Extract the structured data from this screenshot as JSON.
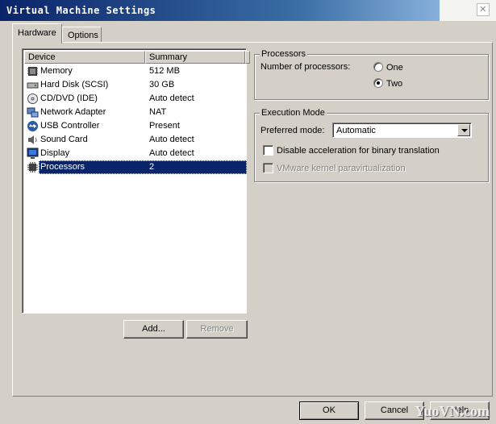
{
  "window": {
    "title": "Virtual Machine Settings"
  },
  "tabs": [
    {
      "label": "Hardware",
      "active": true
    },
    {
      "label": "Options",
      "active": false
    }
  ],
  "device_list": {
    "columns": [
      "Device",
      "Summary"
    ],
    "rows": [
      {
        "device": "Memory",
        "summary": "512 MB",
        "icon": "memory-icon"
      },
      {
        "device": "Hard Disk (SCSI)",
        "summary": "30 GB",
        "icon": "hard-disk-icon"
      },
      {
        "device": "CD/DVD (IDE)",
        "summary": "Auto detect",
        "icon": "cd-dvd-icon"
      },
      {
        "device": "Network Adapter",
        "summary": "NAT",
        "icon": "network-adapter-icon"
      },
      {
        "device": "USB Controller",
        "summary": "Present",
        "icon": "usb-icon"
      },
      {
        "device": "Sound Card",
        "summary": "Auto detect",
        "icon": "sound-card-icon"
      },
      {
        "device": "Display",
        "summary": "Auto detect",
        "icon": "display-icon"
      },
      {
        "device": "Processors",
        "summary": "2",
        "icon": "processor-icon",
        "selected": true
      }
    ]
  },
  "list_buttons": {
    "add": "Add...",
    "remove": "Remove"
  },
  "processors_group": {
    "title": "Processors",
    "count_label": "Number of processors:",
    "options": [
      "One",
      "Two"
    ],
    "selected": "Two"
  },
  "execution_group": {
    "title": "Execution Mode",
    "preferred_mode_label": "Preferred mode:",
    "preferred_mode_value": "Automatic",
    "disable_accel_label": "Disable acceleration for binary translation",
    "disable_accel_checked": false,
    "paravirt_label": "VMware kernel paravirtualization",
    "paravirt_checked": false,
    "paravirt_enabled": false
  },
  "dialog_buttons": {
    "ok": "OK",
    "cancel": "Cancel",
    "help": "Help"
  },
  "watermark": "YuoVN.com",
  "colors": {
    "selection": "#0a246a",
    "face": "#d4d0c8",
    "titlebar": "#0a246a"
  }
}
